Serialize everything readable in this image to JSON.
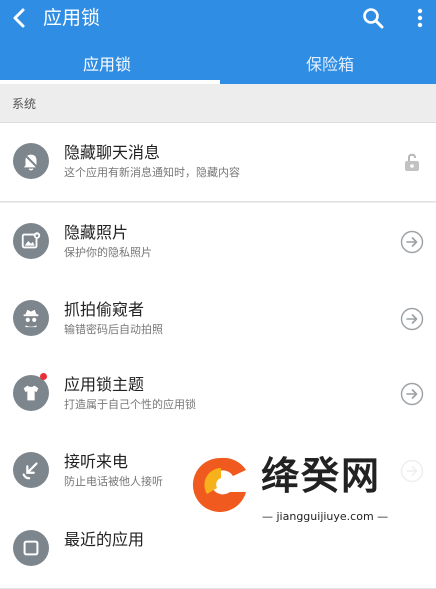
{
  "appbar": {
    "title": "应用锁",
    "color": "#2f8de4"
  },
  "tabs": [
    {
      "label": "应用锁",
      "selected": true
    },
    {
      "label": "保险箱",
      "selected": false
    }
  ],
  "section": {
    "label": "系统"
  },
  "items": [
    {
      "name": "隐藏聊天消息",
      "desc": "这个应用有新消息通知时，隐藏内容",
      "icon": "bell-off-icon",
      "trailing": "lock-open-icon"
    },
    {
      "name": "隐藏照片",
      "desc": "保护你的隐私照片",
      "icon": "photo-lock-icon",
      "trailing": "arrow-right-circle-icon"
    },
    {
      "name": "抓拍偷窥者",
      "desc": "输错密码后自动拍照",
      "icon": "spy-icon",
      "trailing": "arrow-right-circle-icon"
    },
    {
      "name": "应用锁主题",
      "desc": "打造属于自己个性的应用锁",
      "icon": "tshirt-icon",
      "trailing": "arrow-right-circle-icon",
      "badge": true
    },
    {
      "name": "接听来电",
      "desc": "防止电话被他人接听",
      "icon": "incoming-call-icon",
      "trailing": "arrow-right-circle-icon"
    },
    {
      "name": "最近的应用",
      "desc": "",
      "icon": "recent-apps-icon",
      "trailing": "arrow-right-circle-icon"
    }
  ],
  "watermark": {
    "text": "绛癸网",
    "url": "— jiangguijiuye.com —"
  }
}
